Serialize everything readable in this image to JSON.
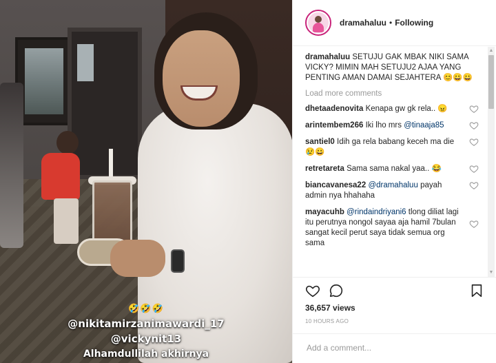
{
  "video": {
    "overlay_emoji": "🤣🤣🤣",
    "overlay_lines": [
      "@nikitamirzanimawardi_17",
      "@vickynit13",
      "Alhamdullilah akhirnya"
    ]
  },
  "header": {
    "username": "dramahaluu",
    "separator": "•",
    "follow_status": "Following"
  },
  "caption": {
    "username": "dramahaluu",
    "text": "SETUJU GAK MBAK NIKI SAMA VICKY? MIMIN MAH SETUJU2 AJAA YANG PENTING AMAN DAMAI SEJAHTERA",
    "emoji": "😊😀😀"
  },
  "load_more": "Load more comments",
  "comments": [
    {
      "username": "dhetaadenovita",
      "text": "Kenapa gw gk rela..",
      "emoji": "😠"
    },
    {
      "username": "arintembem266",
      "text": "Iki lho mrs",
      "mention": "@tinaaja85",
      "emoji": ""
    },
    {
      "username": "santiel0",
      "text": "Idih ga rela babang keceh ma die",
      "emoji": "😢😀"
    },
    {
      "username": "retretareta",
      "text": "Sama sama nakal yaa..",
      "emoji": "😂"
    },
    {
      "username": "biancavanesa22",
      "mention": "@dramahaluu",
      "text": "payah admin nya hhahaha",
      "emoji": ""
    },
    {
      "username": "mayacuhb",
      "mention": "@rindaindriyani6",
      "text": "tlong diliat lagi itu perutnya nongol sayaa aja hamil 7bulan sangat kecil perut saya tidak semua org sama",
      "emoji": ""
    }
  ],
  "icons": {
    "like": "heart-icon",
    "comment": "comment-icon",
    "save": "bookmark-icon"
  },
  "stats": {
    "views": "36,657 views",
    "time_ago": "10 HOURS AGO"
  },
  "add_comment": {
    "placeholder": "Add a comment..."
  }
}
